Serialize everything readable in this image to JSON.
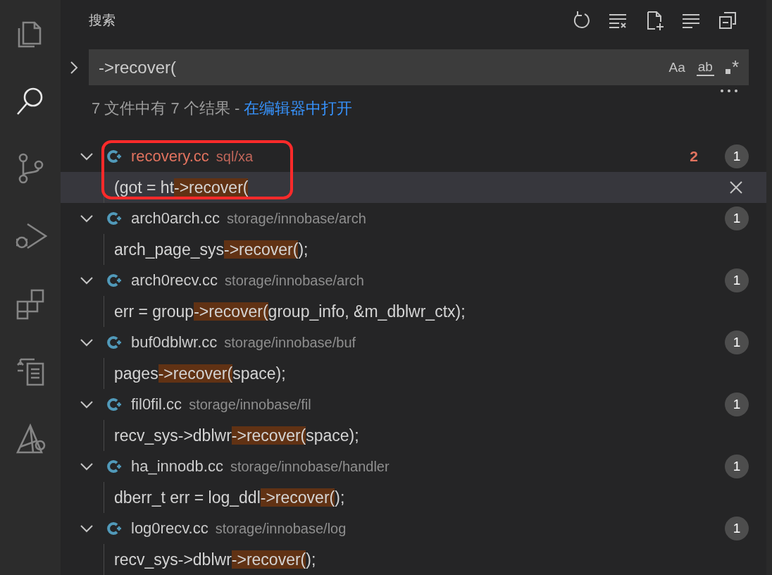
{
  "activity_bar": {
    "items": [
      {
        "kind": "files",
        "selected": false
      },
      {
        "kind": "search",
        "selected": true
      },
      {
        "kind": "source-control",
        "selected": false
      },
      {
        "kind": "run-debug",
        "selected": false
      },
      {
        "kind": "extensions",
        "selected": false
      },
      {
        "kind": "remote",
        "selected": false
      },
      {
        "kind": "tool",
        "selected": false
      }
    ]
  },
  "header": {
    "title": "搜索",
    "actions": [
      {
        "kind": "refresh"
      },
      {
        "kind": "clear"
      },
      {
        "kind": "new-file"
      },
      {
        "kind": "lines"
      },
      {
        "kind": "collapse"
      }
    ]
  },
  "search": {
    "replace_expanded": false,
    "value": "->recover(",
    "options": [
      {
        "kind": "case",
        "label": "Aa",
        "on": false
      },
      {
        "kind": "word",
        "label": "ab",
        "on": false
      },
      {
        "kind": "regex",
        "label": "*",
        "on": false
      }
    ]
  },
  "summary": {
    "text": "7 文件中有 7 个结果 - ",
    "link": "在编辑器中打开"
  },
  "files": [
    {
      "name": "recovery.cc",
      "path": "sql/xa",
      "modified": true,
      "problems": "2",
      "count": "1",
      "expanded": true,
      "matches": [
        {
          "before": "(got = ht",
          "match": "->recover(",
          "hovered": true
        }
      ]
    },
    {
      "name": "arch0arch.cc",
      "path": "storage/innobase/arch",
      "modified": false,
      "count": "1",
      "expanded": true,
      "matches": [
        {
          "before": "arch_page_sys",
          "match": "->recover(",
          "after": ");",
          "hovered": false
        }
      ]
    },
    {
      "name": "arch0recv.cc",
      "path": "storage/innobase/arch",
      "modified": false,
      "count": "1",
      "expanded": true,
      "matches": [
        {
          "before": "err = group",
          "match": "->recover(",
          "after": "group_info, &m_dblwr_ctx);",
          "hovered": false
        }
      ]
    },
    {
      "name": "buf0dblwr.cc",
      "path": "storage/innobase/buf",
      "modified": false,
      "count": "1",
      "expanded": true,
      "matches": [
        {
          "before": "pages",
          "match": "->recover(",
          "after": "space);",
          "hovered": false
        }
      ]
    },
    {
      "name": "fil0fil.cc",
      "path": "storage/innobase/fil",
      "modified": false,
      "count": "1",
      "expanded": true,
      "matches": [
        {
          "before": "recv_sys->dblwr",
          "match": "->recover(",
          "after": "space);",
          "hovered": false
        }
      ]
    },
    {
      "name": "ha_innodb.cc",
      "path": "storage/innobase/handler",
      "modified": false,
      "count": "1",
      "expanded": true,
      "matches": [
        {
          "before": "dberr_t err = log_ddl",
          "match": "->recover(",
          "after": ");",
          "hovered": false
        }
      ]
    },
    {
      "name": "log0recv.cc",
      "path": "storage/innobase/log",
      "modified": false,
      "count": "1",
      "expanded": true,
      "matches": [
        {
          "before": "recv_sys->dblwr",
          "match": "->recover(",
          "after": ");",
          "hovered": false
        }
      ]
    }
  ],
  "annotations": [
    {
      "kind": "outline",
      "color": "#ff2a2a"
    }
  ]
}
